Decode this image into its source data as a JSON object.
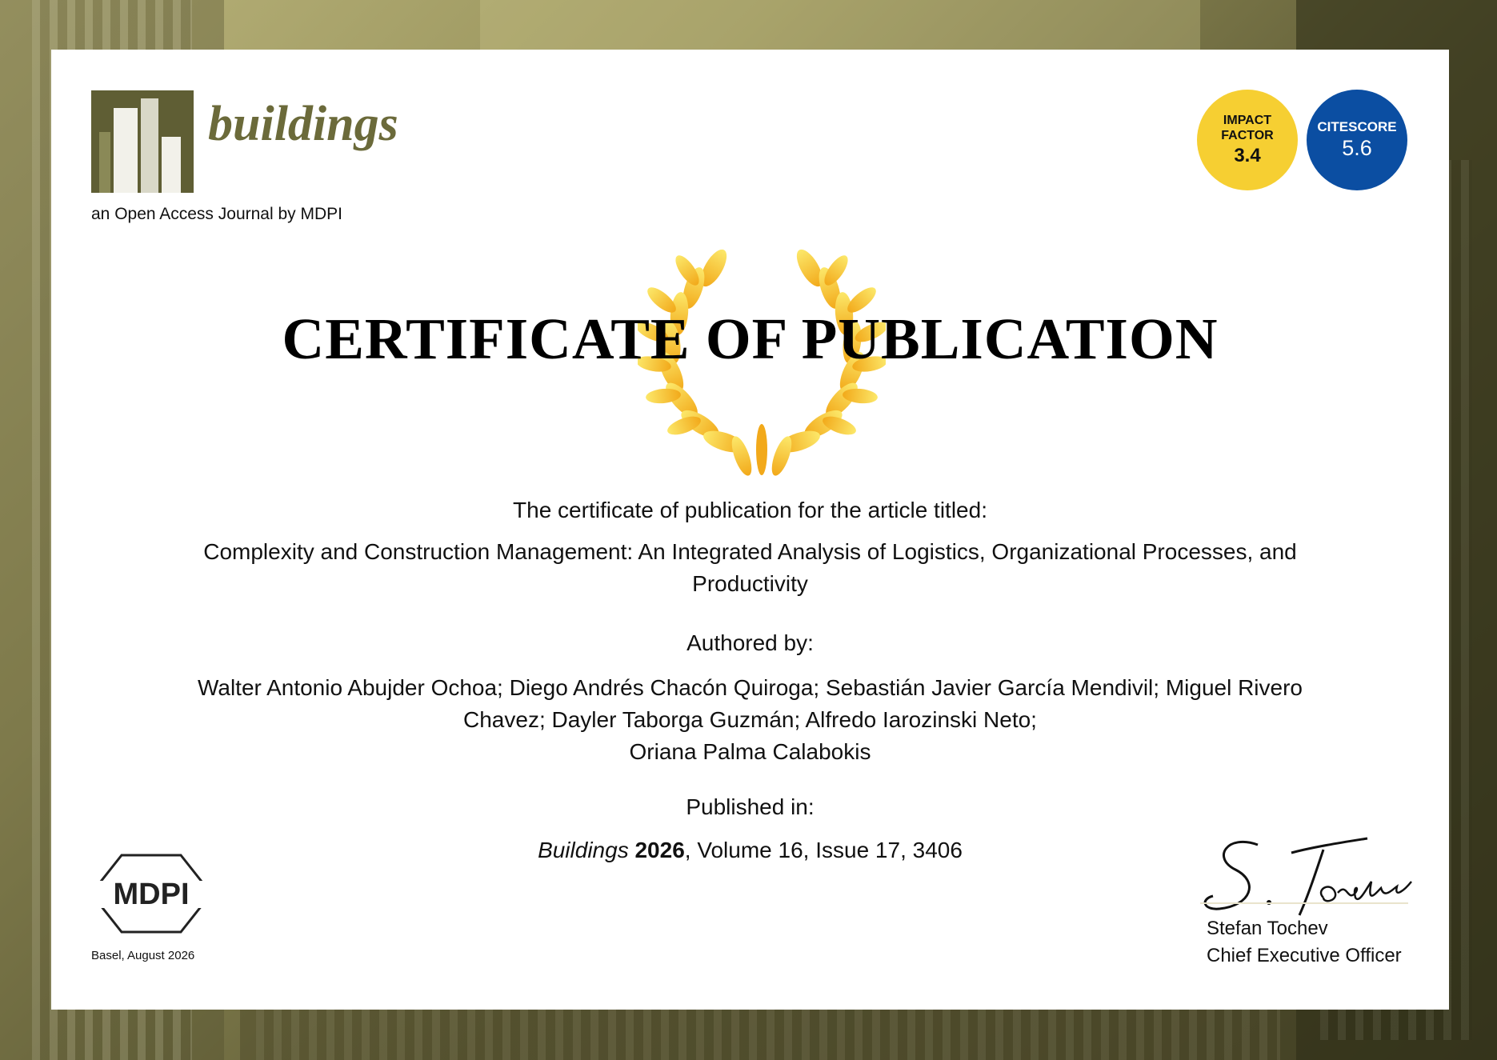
{
  "journal": {
    "name": "buildings",
    "tagline": "an Open Access Journal by MDPI"
  },
  "metrics": {
    "impact_factor_label_1": "IMPACT",
    "impact_factor_label_2": "FACTOR",
    "impact_factor_value": "3.4",
    "citescore_label": "CITESCORE",
    "citescore_value": "5.6"
  },
  "certificate": {
    "title": "CERTIFICATE OF PUBLICATION",
    "intro": "The certificate of publication for the article titled:",
    "article_title": "Complexity and Construction Management: An Integrated Analysis of Logistics, Organizational Processes, and Productivity",
    "authored_heading": "Authored by:",
    "authors_line_1": "Walter Antonio Abujder Ochoa; Diego Andrés Chacón Quiroga; Sebastián Javier García Mendivil; Miguel Rivero",
    "authors_line_2": "Chavez; Dayler Taborga Guzmán; Alfredo Iarozinski Neto;",
    "authors_line_3": "Oriana Palma Calabokis",
    "published_heading": "Published in:",
    "citation_journal": "Buildings",
    "citation_year": "2026",
    "citation_rest": ", Volume 16, Issue 17, 3406"
  },
  "publisher": {
    "logo_text": "MDPI",
    "place_date": "Basel, August 2026"
  },
  "signatory": {
    "signature_text": "S. Tochev",
    "name": "Stefan Tochev",
    "role": "Chief Executive Officer"
  },
  "colors": {
    "journal_olive": "#6b6a3a",
    "impact_factor_yellow": "#f6cf32",
    "citescore_blue": "#0b4ea2",
    "wreath_gold": "#f2b21f"
  }
}
